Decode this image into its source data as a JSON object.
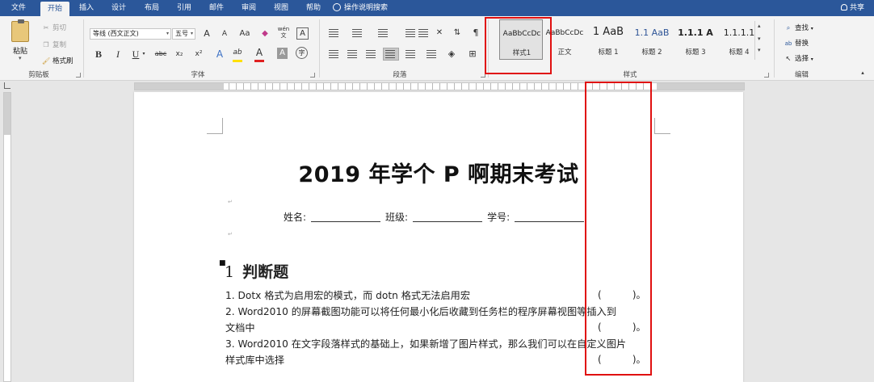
{
  "tabs": [
    "文件",
    "开始",
    "插入",
    "设计",
    "布局",
    "引用",
    "邮件",
    "审阅",
    "视图",
    "帮助"
  ],
  "active_tab": "开始",
  "tell_me": "操作说明搜索",
  "share": "共享",
  "clipboard": {
    "paste": "粘贴",
    "cut": "剪切",
    "copy": "复制",
    "format_painter": "格式刷",
    "group": "剪贴板"
  },
  "font": {
    "name": "等线 (西文正文)",
    "size": "五号",
    "group": "字体",
    "phonetic_glyph": "wén",
    "buttons": {
      "grow": "A",
      "shrink": "A",
      "case": "Aa",
      "bold": "B",
      "italic": "I",
      "underline": "U",
      "strike": "abc",
      "sub": "x₂",
      "sup": "x²",
      "effects": "A",
      "highlight": "ab",
      "color": "A",
      "shade": "A",
      "enclose": "字",
      "border": "A"
    }
  },
  "paragraph": {
    "group": "段落"
  },
  "styles": {
    "group": "样式",
    "items": [
      {
        "sample": "AaBbCcDc",
        "name": "样式1"
      },
      {
        "sample": "AaBbCcDc",
        "name": "正文"
      },
      {
        "sample": "1  AaB",
        "name": "标题 1"
      },
      {
        "sample": "1.1  AaB",
        "name": "标题 2"
      },
      {
        "sample": "1.1.1  A",
        "name": "标题 3"
      },
      {
        "sample": "1.1.1.1",
        "name": "标题 4"
      }
    ]
  },
  "editing": {
    "find": "查找",
    "replace": "替换",
    "select": "选择",
    "group": "编辑"
  },
  "document": {
    "title": "2019 年学个 P 啊期末考试",
    "name_label": "姓名:",
    "class_label": "班级:",
    "id_label": "学号:",
    "heading_num": "1",
    "heading_text": "判断题",
    "q1": "1. Dotx 格式为启用宏的模式，而 dotn 格式无法启用宏",
    "q2a": "2. Word2010  的屏幕截图功能可以将任何最小化后收藏到任务栏的程序屏幕视图等插入到",
    "q2b": "文档中",
    "q3a": "3. Word2010 在文字段落样式的基础上，如果新增了图片样式，那么我们可以在自定义图片",
    "q3b": "样式库中选择",
    "answer_blank": "(          )。"
  },
  "colors": {
    "ribbon_tab_bg": "#2b579a",
    "annotation": "#e01010",
    "highlight_yellow": "#ffe000",
    "font_red": "#e02020"
  }
}
